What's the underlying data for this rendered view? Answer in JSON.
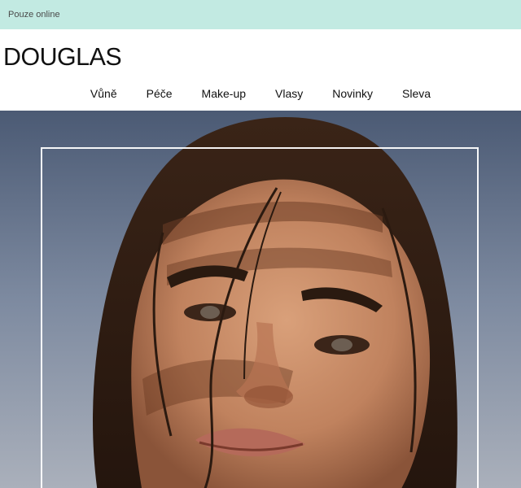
{
  "topbar": {
    "text": "Pouze online"
  },
  "brand": {
    "logo_text": "DOUGLAS"
  },
  "nav": {
    "items": [
      {
        "label": "Vůně"
      },
      {
        "label": "Péče"
      },
      {
        "label": "Make-up"
      },
      {
        "label": "Vlasy"
      },
      {
        "label": "Novinky"
      },
      {
        "label": "Sleva"
      }
    ]
  },
  "hero": {
    "image": "portrait-woman-sun-shadow"
  },
  "colors": {
    "topbar_bg": "#c2eae2",
    "sky_top": "#4e5f7a",
    "sky_bottom": "#a7aebb"
  }
}
